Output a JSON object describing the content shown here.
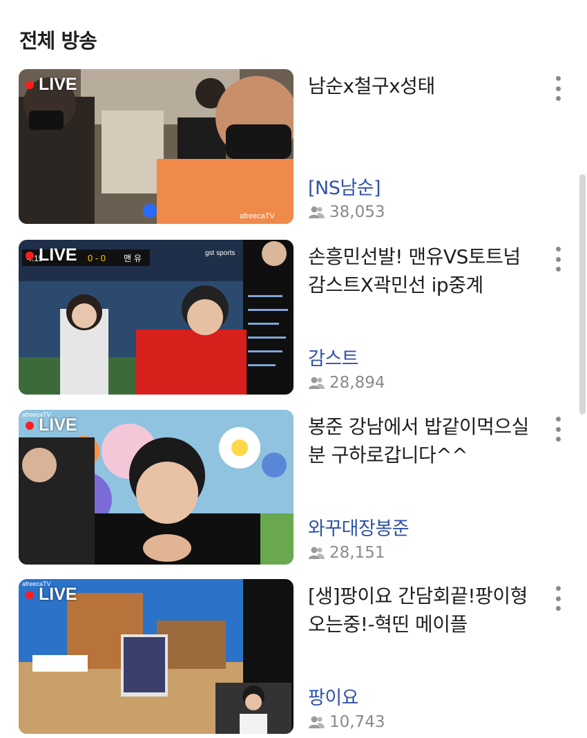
{
  "header": {
    "title": "전체 방송"
  },
  "live_label": "LIVE",
  "broadcasts": [
    {
      "title": "남순x철구x성태",
      "channel": "[NS남순]",
      "viewers": "38,053",
      "thumb_text": "afreecaTV"
    },
    {
      "title": "손흥민선발! 맨유VS토트넘 감스트X곽민선 ip중계",
      "channel": "감스트",
      "viewers": "28,894",
      "thumb_text": "gst sports",
      "scoreboard": {
        "time": "4:15",
        "score": "0 - 0",
        "team": "맨 유"
      }
    },
    {
      "title": "봉준 강남에서 밥같이먹으실 분 구하로갑니다^^",
      "channel": "와꾸대장봉준",
      "viewers": "28,151",
      "thumb_text": "afreecaTV"
    },
    {
      "title": "[생]팡이요 간담회끝!팡이형오는중!-혁띤 메이플",
      "channel": "팡이요",
      "viewers": "10,743",
      "thumb_text": "afreecaTV"
    }
  ],
  "colors": {
    "accent": "#2f52a8",
    "live": "#ff1e1e",
    "muted": "#8a8a8a"
  }
}
